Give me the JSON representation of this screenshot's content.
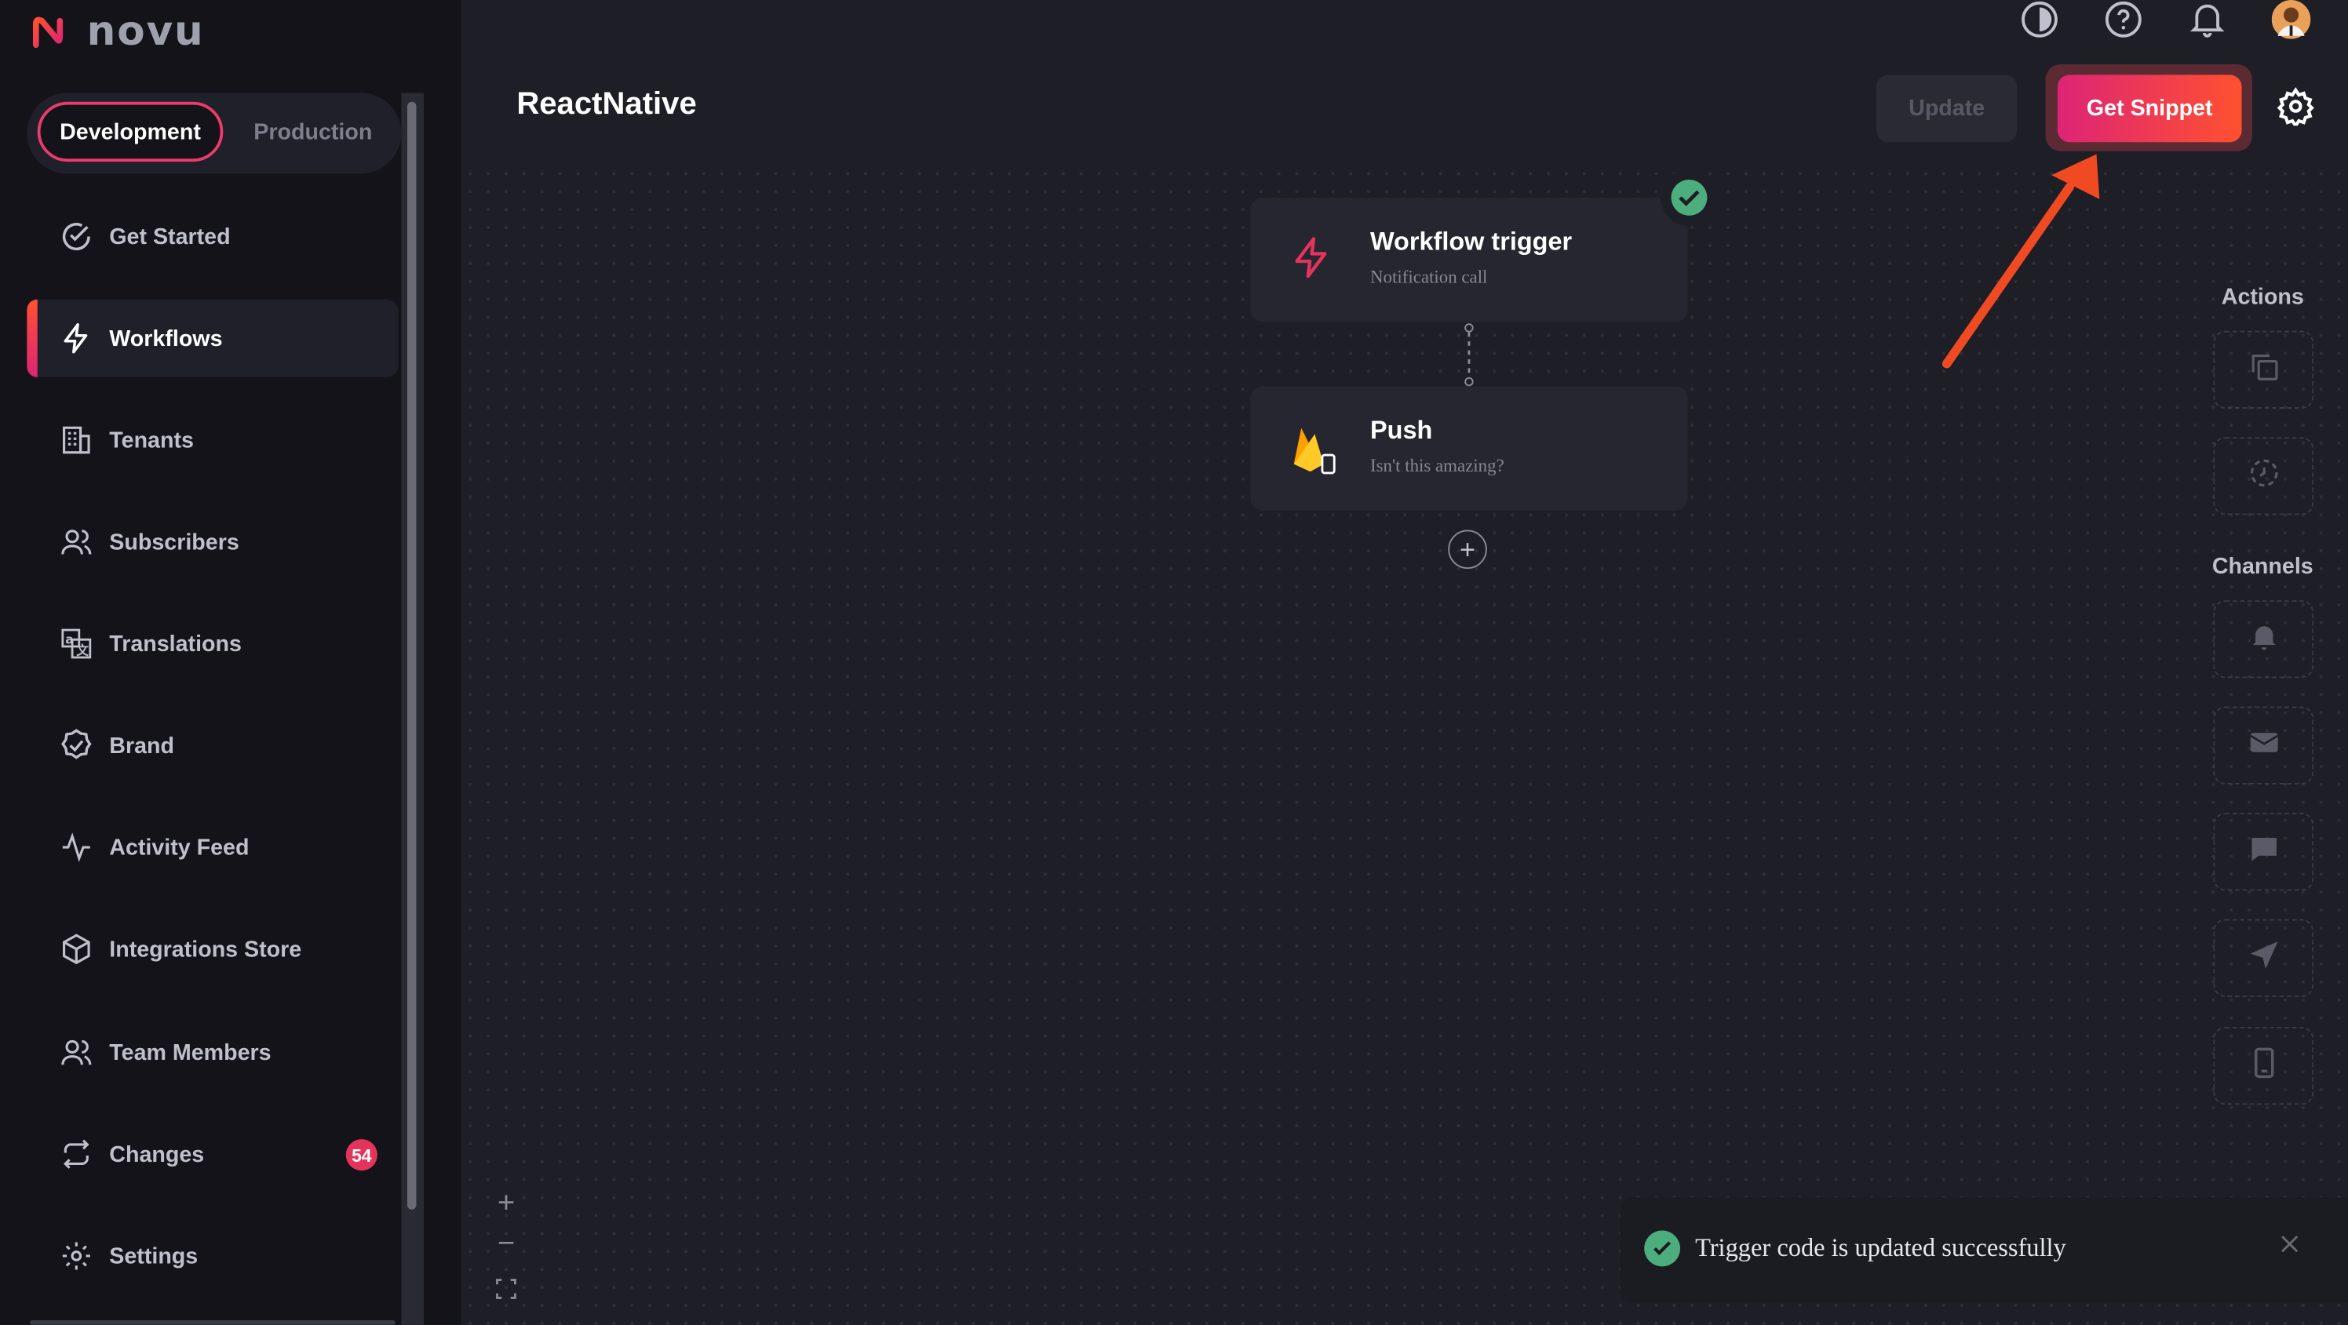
{
  "app": {
    "logo_text": "novu"
  },
  "environment": {
    "development": "Development",
    "production": "Production"
  },
  "sidebar": {
    "items": [
      {
        "label": "Get Started",
        "icon": "check-circle-icon"
      },
      {
        "label": "Workflows",
        "icon": "bolt-icon",
        "active": true
      },
      {
        "label": "Tenants",
        "icon": "building-icon"
      },
      {
        "label": "Subscribers",
        "icon": "users-icon"
      },
      {
        "label": "Translations",
        "icon": "translate-icon"
      },
      {
        "label": "Brand",
        "icon": "badge-check-icon"
      },
      {
        "label": "Activity Feed",
        "icon": "activity-icon"
      },
      {
        "label": "Integrations Store",
        "icon": "box-icon"
      },
      {
        "label": "Team Members",
        "icon": "users-icon"
      },
      {
        "label": "Changes",
        "icon": "repeat-icon",
        "badge": "54"
      },
      {
        "label": "Settings",
        "icon": "gear-icon"
      }
    ]
  },
  "header": {
    "title": "ReactNative",
    "update_label": "Update",
    "snippet_label": "Get Snippet"
  },
  "workflow": {
    "trigger": {
      "title": "Workflow trigger",
      "subtitle": "Notification call"
    },
    "push": {
      "title": "Push",
      "subtitle": "Isn't this amazing?"
    }
  },
  "right_panel": {
    "actions_label": "Actions",
    "channels_label": "Channels"
  },
  "toast": {
    "message": "Trigger code is updated successfully"
  },
  "colors": {
    "accent_start": "#dd2476",
    "accent_end": "#ff512f",
    "success": "#4cae7d",
    "annotation_arrow": "#f04a23"
  }
}
